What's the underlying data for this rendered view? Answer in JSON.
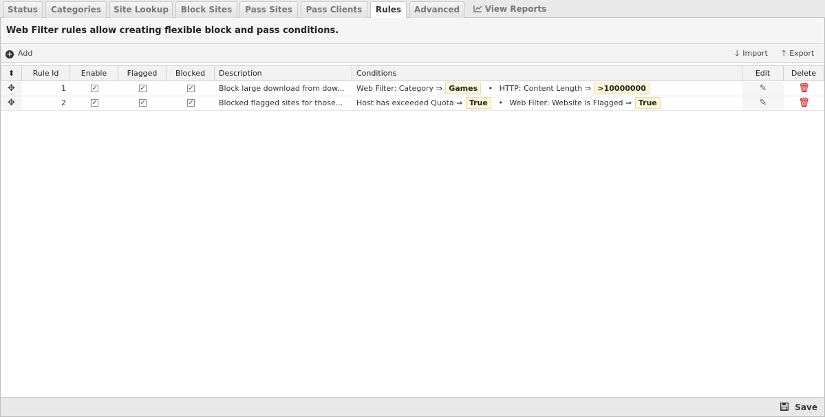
{
  "tabs": [
    {
      "label": "Status"
    },
    {
      "label": "Categories"
    },
    {
      "label": "Site Lookup"
    },
    {
      "label": "Block Sites"
    },
    {
      "label": "Pass Sites"
    },
    {
      "label": "Pass Clients"
    },
    {
      "label": "Rules",
      "active": true
    },
    {
      "label": "Advanced"
    },
    {
      "label": "View Reports",
      "icon": "line-chart-icon"
    }
  ],
  "description": "Web Filter rules allow creating flexible block and pass conditions.",
  "toolbar": {
    "add_label": "Add",
    "import_label": "Import",
    "export_label": "Export"
  },
  "grid": {
    "columns": {
      "drag": "⬍",
      "rule_id": "Rule Id",
      "enable": "Enable",
      "flagged": "Flagged",
      "blocked": "Blocked",
      "description": "Description",
      "conditions": "Conditions",
      "edit": "Edit",
      "delete": "Delete"
    },
    "rows": [
      {
        "rule_id": "1",
        "enable": true,
        "flagged": true,
        "blocked": true,
        "description": "Block large download from dow...",
        "conditions": [
          {
            "label": "Web Filter: Category ⇒",
            "value": "Games"
          },
          {
            "label": "HTTP: Content Length ⇒",
            "value": ">10000000"
          }
        ]
      },
      {
        "rule_id": "2",
        "enable": true,
        "flagged": true,
        "blocked": true,
        "description": "Blocked flagged sites for those...",
        "conditions": [
          {
            "label": "Host has exceeded Quota ⇒",
            "value": "True"
          },
          {
            "label": "Web Filter: Website is Flagged ⇒",
            "value": "True"
          }
        ]
      }
    ]
  },
  "footer": {
    "save_label": "Save"
  },
  "colors": {
    "delete_icon": "#d40000",
    "condition_pill_bg": "#fbf6d8"
  }
}
